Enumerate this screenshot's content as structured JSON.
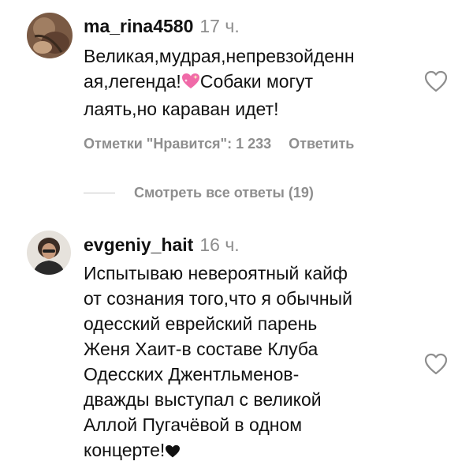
{
  "comments": [
    {
      "username": "ma_rina4580",
      "time": "17 ч.",
      "text_lines": [
        "Великая,мудрая,непревзойденн",
        "ая,легенда!",
        "Собаки могут",
        "лаять,но караван идет!"
      ],
      "emoji": "sparkling-heart",
      "likes_label": "Отметки \"Нравится\": 1 233",
      "reply_label": "Ответить",
      "view_replies_label": "Смотреть все ответы (19)"
    },
    {
      "username": "evgeniy_hait",
      "time": "16 ч.",
      "text_lines": [
        "Испытываю невероятный кайф",
        "от сознания того,что я обычный",
        "одесский еврейский парень",
        "Женя Хаит-в составе Клуба",
        "Одесских Джентльменов-",
        "дважды выступал с великой",
        "Аллой Пугачёвой в одном",
        "концерте!"
      ],
      "emoji": "black-heart"
    }
  ],
  "icons": {
    "like": "heart-outline-icon"
  },
  "colors": {
    "text": "#111111",
    "secondary": "#8e8e8e",
    "divider": "#c7c7c7"
  }
}
